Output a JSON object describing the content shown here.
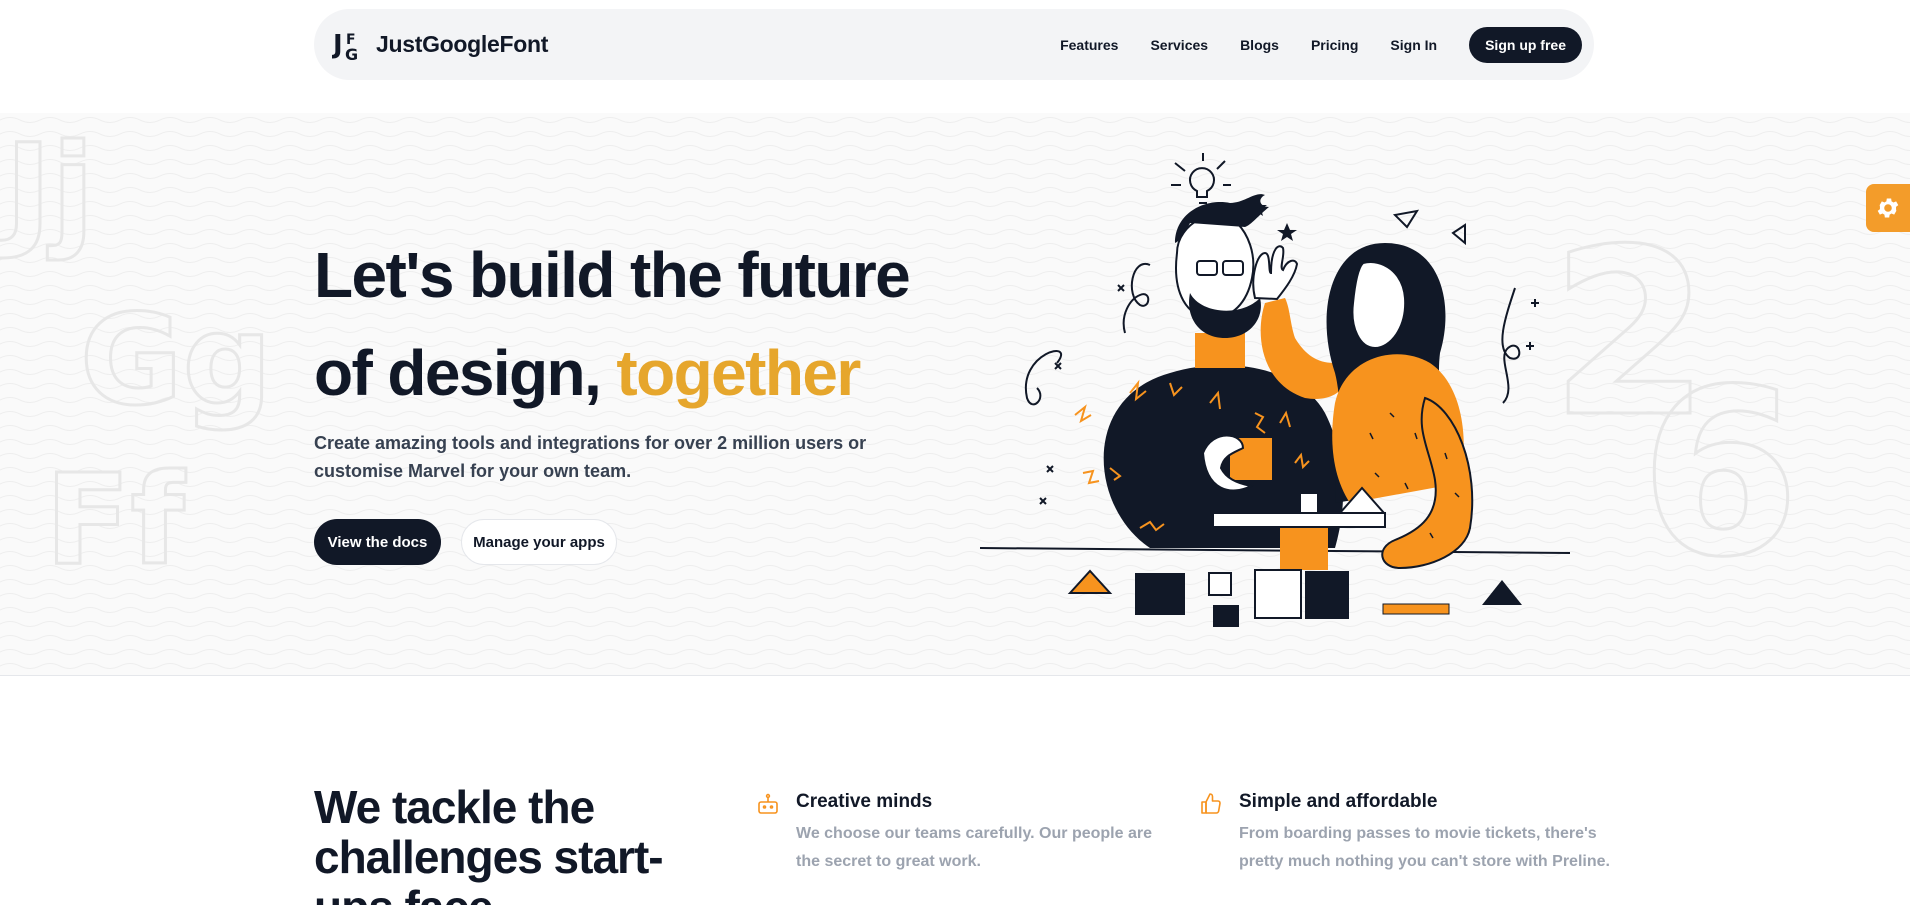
{
  "nav": {
    "brand": "JustGoogleFont",
    "links": [
      "Features",
      "Services",
      "Blogs",
      "Pricing",
      "Sign In"
    ],
    "cta": "Sign up free"
  },
  "hero": {
    "title_main": "Let's build the future of design,",
    "title_accent": "together",
    "subtitle": "Create amazing tools and integrations for over 2 million users or customise Marvel for your own team.",
    "primary_button": "View the docs",
    "secondary_button": "Manage your apps",
    "decor_letters_left": [
      "Jj",
      "Gg",
      "Ff"
    ],
    "decor_digits_right": [
      "2",
      "6"
    ]
  },
  "section2": {
    "title": "We tackle the challenges start-ups face",
    "features": [
      {
        "icon": "robot-icon",
        "title": "Creative minds",
        "desc": "We choose our teams carefully. Our people are the secret to great work."
      },
      {
        "icon": "thumbs-up-icon",
        "title": "Simple and affordable",
        "desc": "From boarding passes to movie tickets, there's pretty much nothing you can't store with Preline."
      }
    ]
  },
  "colors": {
    "accent": "#e6a62c",
    "orange": "#f7931e",
    "dark": "#111827",
    "muted": "#9ca3af"
  }
}
